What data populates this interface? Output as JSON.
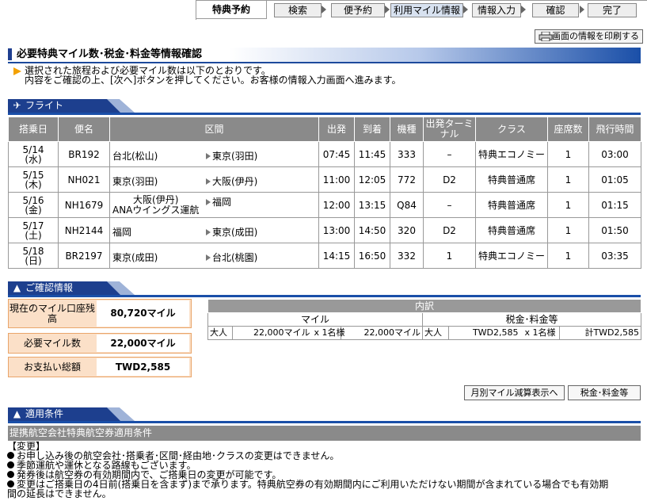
{
  "steps": {
    "title": "特典予約",
    "items": [
      "検索",
      "便予約",
      "利用マイル情報",
      "情報入力",
      "確認",
      "完了"
    ]
  },
  "print_button": "画面の情報を印刷する",
  "page_title": "必要特典マイル数･税金･料金等情報確認",
  "intro": {
    "line1": "選択された旅程および必要マイル数は以下のとおりです。",
    "line2": "内容をご確認の上、[次へ]ボタンを押してください。お客様の情報入力画面へ進みます。"
  },
  "flight_section": {
    "label": "フライト",
    "icon": "airplane-icon"
  },
  "flight_table": {
    "headers": [
      "搭乗日",
      "便名",
      "区間",
      "出発",
      "到着",
      "機種",
      "出発ターミナル",
      "クラス",
      "座席数",
      "飛行時間"
    ],
    "rows": [
      {
        "date": "5/14",
        "dow": "(水)",
        "flight": "BR192",
        "from": "台北(松山)",
        "from_sub": "",
        "to": "東京(羽田)",
        "dep": "07:45",
        "arr": "11:45",
        "aircraft": "333",
        "terminal": "–",
        "class": "特典エコノミー",
        "seats": "1",
        "duration": "03:00"
      },
      {
        "date": "5/15",
        "dow": "(木)",
        "flight": "NH021",
        "from": "東京(羽田)",
        "from_sub": "",
        "to": "大阪(伊丹)",
        "dep": "11:00",
        "arr": "12:05",
        "aircraft": "772",
        "terminal": "D2",
        "class": "特典普通席",
        "seats": "1",
        "duration": "01:05"
      },
      {
        "date": "5/16",
        "dow": "(金)",
        "flight": "NH1679",
        "from": "大阪(伊丹)",
        "from_sub": "ANAウイングス運航",
        "to": "福岡",
        "dep": "12:00",
        "arr": "13:15",
        "aircraft": "Q84",
        "terminal": "–",
        "class": "特典普通席",
        "seats": "1",
        "duration": "01:15"
      },
      {
        "date": "5/17",
        "dow": "(土)",
        "flight": "NH2144",
        "from": "福岡",
        "from_sub": "",
        "to": "東京(成田)",
        "dep": "13:00",
        "arr": "14:50",
        "aircraft": "320",
        "terminal": "D2",
        "class": "特典普通席",
        "seats": "1",
        "duration": "01:50"
      },
      {
        "date": "5/18",
        "dow": "(日)",
        "flight": "BR2197",
        "from": "東京(成田)",
        "from_sub": "",
        "to": "台北(桃園)",
        "dep": "14:15",
        "arr": "16:50",
        "aircraft": "332",
        "terminal": "1",
        "class": "特典エコノミー",
        "seats": "1",
        "duration": "03:35"
      }
    ]
  },
  "confirm_section": {
    "label": "ご確認情報",
    "icon": "person-icon"
  },
  "summary": [
    {
      "label": "現在のマイル口座残高",
      "value": "80,720マイル"
    },
    {
      "label": "必要マイル数",
      "value": "22,000マイル"
    },
    {
      "label": "お支払い総額",
      "value": "TWD2,585"
    }
  ],
  "breakdown": {
    "title": "内訳",
    "miles_header": "マイル",
    "tax_header": "税金･料金等",
    "row": {
      "pax": "大人",
      "miles_unit": "22,000マイル",
      "x1": "x",
      "count1": "1名様",
      "miles_total": "22,000マイル",
      "pax2": "大人",
      "tax_unit": "TWD2,585",
      "x2": "x",
      "count2": "1名様",
      "tax_total": "計TWD2,585"
    }
  },
  "buttons": {
    "monthly": "月別マイル減算表示へ",
    "tax": "税金･料金等"
  },
  "conditions_section": {
    "label": "適用条件",
    "icon": "person-icon"
  },
  "conditions": {
    "bar": "提携航空会社特典航空券適用条件",
    "heading": "【変更】",
    "items": [
      "お申し込み後の航空会社･搭乗者･区間･経由地･クラスの変更はできません。",
      "季節運航や運休となる路線もございます。",
      "発券後は航空券の有効期間内で、ご搭乗日の変更が可能です。",
      "変更はご搭乗日の4日前(搭乗日を含まず)まで承ります。特典航空券の有効期間内にご利用いただけない期間が含まれている場合でも有効期"
    ],
    "continuation": "間の延長はできません。"
  }
}
